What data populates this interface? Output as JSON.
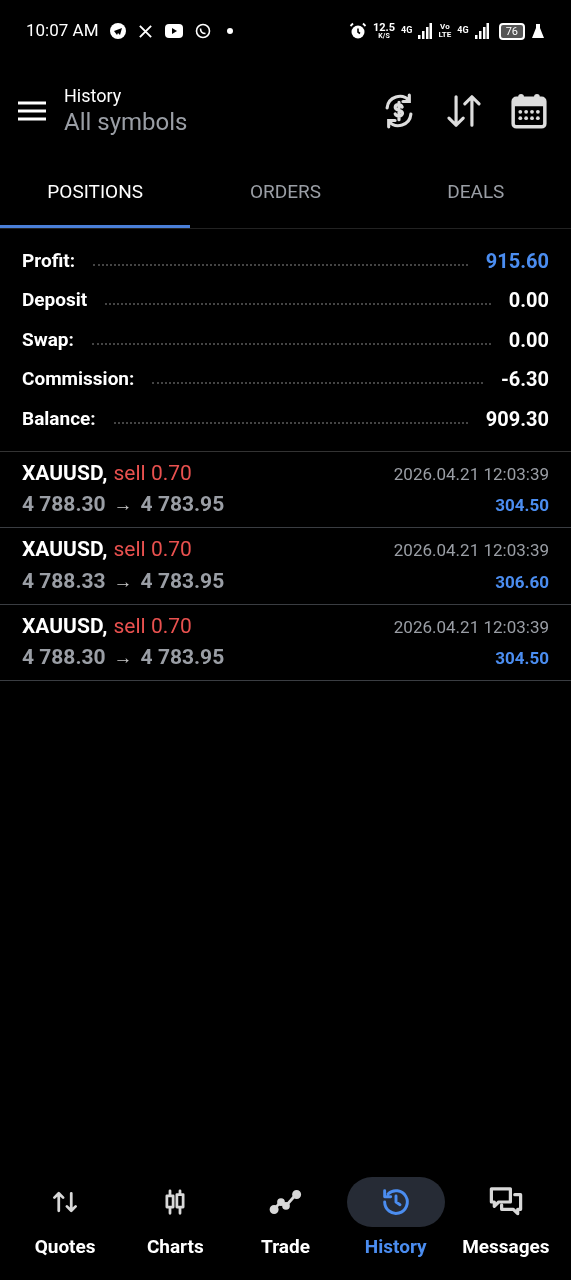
{
  "status_bar": {
    "time": "10:07 AM",
    "speed": "12.5",
    "speed_unit": "K/S",
    "net1": "4G",
    "volte_top": "Vo",
    "volte_bottom": "LTE",
    "net2": "4G",
    "battery": "76"
  },
  "header": {
    "title": "History",
    "subtitle": "All symbols"
  },
  "tabs": [
    {
      "label": "POSITIONS",
      "selected": true
    },
    {
      "label": "ORDERS",
      "selected": false
    },
    {
      "label": "DEALS",
      "selected": false
    }
  ],
  "summary": [
    {
      "label": "Profit:",
      "value": "915.60",
      "emphasized": true
    },
    {
      "label": "Deposit",
      "value": "0.00",
      "emphasized": false
    },
    {
      "label": "Swap:",
      "value": "0.00",
      "emphasized": false
    },
    {
      "label": "Commission:",
      "value": "-6.30",
      "emphasized": false
    },
    {
      "label": "Balance:",
      "value": "909.30",
      "emphasized": false
    }
  ],
  "positions": [
    {
      "symbol": "XAUUSD,",
      "kind": "sell",
      "type": "sell 0.70",
      "open": "4 788.30",
      "arrow": "→",
      "close": "4 783.95",
      "time": "2026.04.21 12:03:39",
      "profit": "304.50"
    },
    {
      "symbol": "XAUUSD,",
      "kind": "sell",
      "type": "sell 0.70",
      "open": "4 788.33",
      "arrow": "→",
      "close": "4 783.95",
      "time": "2026.04.21 12:03:39",
      "profit": "306.60"
    },
    {
      "symbol": "XAUUSD,",
      "kind": "sell",
      "type": "sell 0.70",
      "open": "4 788.30",
      "arrow": "→",
      "close": "4 783.95",
      "time": "2026.04.21 12:03:39",
      "profit": "304.50"
    }
  ],
  "nav": [
    {
      "label": "Quotes",
      "selected": false
    },
    {
      "label": "Charts",
      "selected": false
    },
    {
      "label": "Trade",
      "selected": false
    },
    {
      "label": "History",
      "selected": true
    },
    {
      "label": "Messages",
      "selected": false
    }
  ]
}
